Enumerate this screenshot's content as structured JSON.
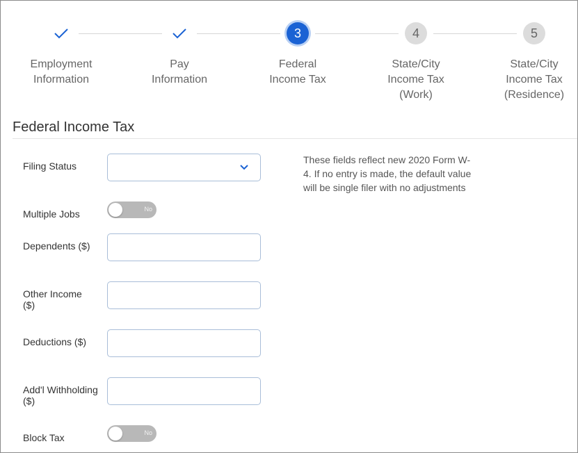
{
  "stepper": {
    "steps": [
      {
        "number": "✓",
        "label": "Employment\nInformation",
        "status": "complete"
      },
      {
        "number": "✓",
        "label": "Pay\nInformation",
        "status": "complete"
      },
      {
        "number": "3",
        "label": "Federal\nIncome Tax",
        "status": "active"
      },
      {
        "number": "4",
        "label": "State/City\nIncome Tax\n(Work)",
        "status": "pending"
      },
      {
        "number": "5",
        "label": "State/City\nIncome Tax\n(Residence)",
        "status": "pending"
      }
    ]
  },
  "section": {
    "title": "Federal Income Tax"
  },
  "form": {
    "filing_status": {
      "label": "Filing Status",
      "value": ""
    },
    "multiple_jobs": {
      "label": "Multiple Jobs",
      "state": "No"
    },
    "dependents": {
      "label": "Dependents ($)",
      "value": ""
    },
    "other_income": {
      "label": "Other Income ($)",
      "value": ""
    },
    "deductions": {
      "label": "Deductions ($)",
      "value": ""
    },
    "addl_withholding": {
      "label": "Add'l Withholding ($)",
      "value": ""
    },
    "block_tax": {
      "label": "Block Tax",
      "state": "No"
    }
  },
  "help_text": "These fields reflect new 2020 Form W-4. If no entry is made, the default value will be single filer with no adjustments",
  "colors": {
    "accent": "#1a62d4",
    "check": "#1a62d4",
    "pending": "#dcdcdc",
    "toggle_off": "#b8b8b8",
    "input_border": "#a8bdd8"
  },
  "icons": {
    "complete": "check-icon",
    "dropdown": "chevron-down-icon"
  }
}
